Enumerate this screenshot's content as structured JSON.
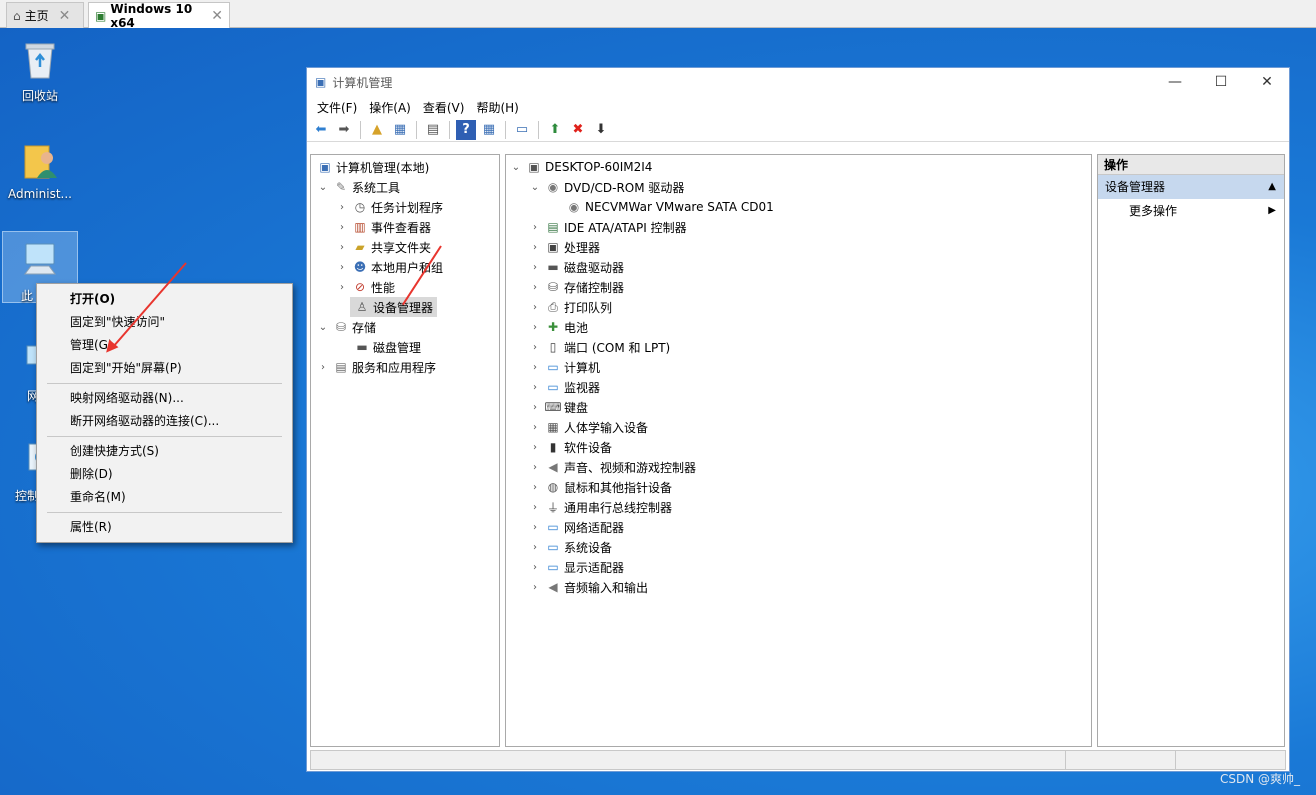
{
  "tabs": [
    {
      "label": "主页",
      "icon": "home-icon"
    },
    {
      "label": "Windows 10 x64",
      "icon": "vm-icon"
    }
  ],
  "desktop": {
    "icons": [
      {
        "label": "回收站",
        "icon": "recycle-bin-icon"
      },
      {
        "label": "Administ...",
        "icon": "user-folder-icon"
      },
      {
        "label": "此",
        "icon": "this-pc-icon"
      },
      {
        "label": "网",
        "icon": "network-icon"
      },
      {
        "label": "控制",
        "icon": "control-panel-icon"
      }
    ]
  },
  "context_menu": {
    "items": [
      "打开(O)",
      "固定到\"快速访问\"",
      "管理(G)",
      "固定到\"开始\"屏幕(P)",
      "映射网络驱动器(N)...",
      "断开网络驱动器的连接(C)...",
      "创建快捷方式(S)",
      "删除(D)",
      "重命名(M)",
      "属性(R)"
    ]
  },
  "window": {
    "title": "计算机管理",
    "controls": {
      "minimize": "—",
      "maximize": "☐",
      "close": "✕"
    },
    "menu": [
      "文件(F)",
      "操作(A)",
      "查看(V)",
      "帮助(H)"
    ],
    "left_tree": [
      {
        "label": "计算机管理(本地)",
        "icon": "computer-mgmt-icon"
      },
      {
        "label": "系统工具",
        "icon": "tools-icon"
      },
      {
        "label": "任务计划程序",
        "icon": "clock-icon"
      },
      {
        "label": "事件查看器",
        "icon": "event-viewer-icon"
      },
      {
        "label": "共享文件夹",
        "icon": "shared-folder-icon"
      },
      {
        "label": "本地用户和组",
        "icon": "users-icon"
      },
      {
        "label": "性能",
        "icon": "performance-icon"
      },
      {
        "label": "设备管理器",
        "icon": "device-manager-icon"
      },
      {
        "label": "存储",
        "icon": "storage-icon"
      },
      {
        "label": "磁盘管理",
        "icon": "disk-mgmt-icon"
      },
      {
        "label": "服务和应用程序",
        "icon": "services-icon"
      }
    ],
    "device_tree": {
      "root": "DESKTOP-60IM2I4",
      "dvd": "DVD/CD-ROM 驱动器",
      "dvd_child": "NECVMWar VMware SATA CD01",
      "categories": [
        "IDE ATA/ATAPI 控制器",
        "处理器",
        "磁盘驱动器",
        "存储控制器",
        "打印队列",
        "电池",
        "端口 (COM 和 LPT)",
        "计算机",
        "监视器",
        "键盘",
        "人体学输入设备",
        "软件设备",
        "声音、视频和游戏控制器",
        "鼠标和其他指针设备",
        "通用串行总线控制器",
        "网络适配器",
        "系统设备",
        "显示适配器",
        "音频输入和输出"
      ]
    },
    "actions": {
      "header": "操作",
      "selected": "设备管理器",
      "more": "更多操作"
    }
  },
  "watermark": "CSDN @爽帅_"
}
